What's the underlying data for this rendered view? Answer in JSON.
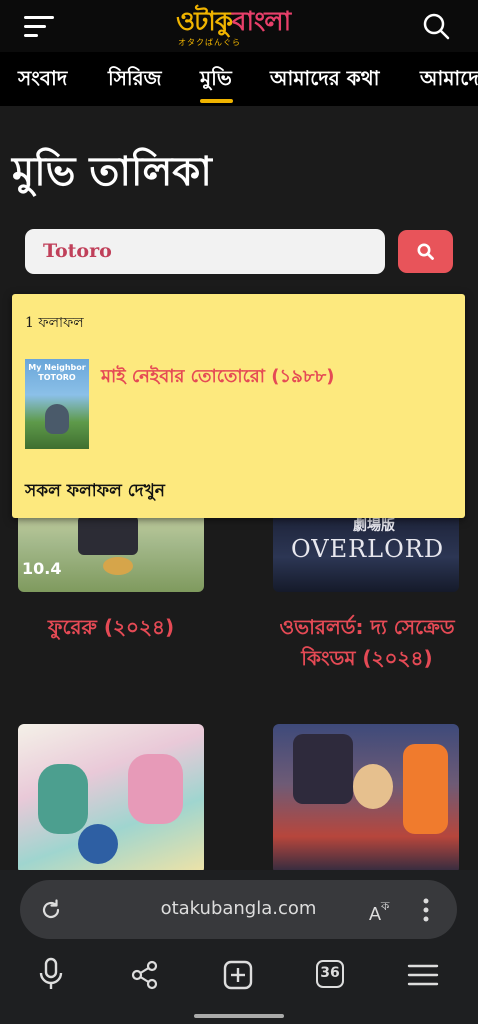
{
  "header": {
    "logo_main_left": "ওটাকু",
    "logo_main_right": "বাংলা",
    "logo_sub": "オタクばんぐら"
  },
  "nav": {
    "items": [
      "সংবাদ",
      "সিরিজ",
      "মুভি",
      "আমাদের কথা",
      "আমাদে"
    ],
    "active": "মুভি"
  },
  "page": {
    "title": "মুভি তালিকা"
  },
  "search": {
    "value": "Totoro"
  },
  "results": {
    "count_label": "1 ফলাফল",
    "item_title": "মাই নেইবার তোতোরো (১৯৮৮)",
    "item_poster_text": "My Neighbor TOTORO",
    "see_all": "সকল ফলাফল দেখুন"
  },
  "movies": [
    {
      "title": "ফুরেরু (২০২৪)",
      "poster_text": "10.4"
    },
    {
      "title_line1": "ওভারলর্ড: দ্য সেক্রেড",
      "title_line2": "কিংডম (২০২৪)",
      "poster_text": "OVERLORD",
      "poster_sub": "劇場版"
    },
    {
      "title": ""
    },
    {
      "title": ""
    }
  ],
  "browser": {
    "url": "otakubangla.com",
    "tab_count": "36"
  },
  "colors": {
    "accent_yellow": "#f0b400",
    "accent_red": "#e54a55",
    "dropdown_bg": "#fde97e"
  }
}
